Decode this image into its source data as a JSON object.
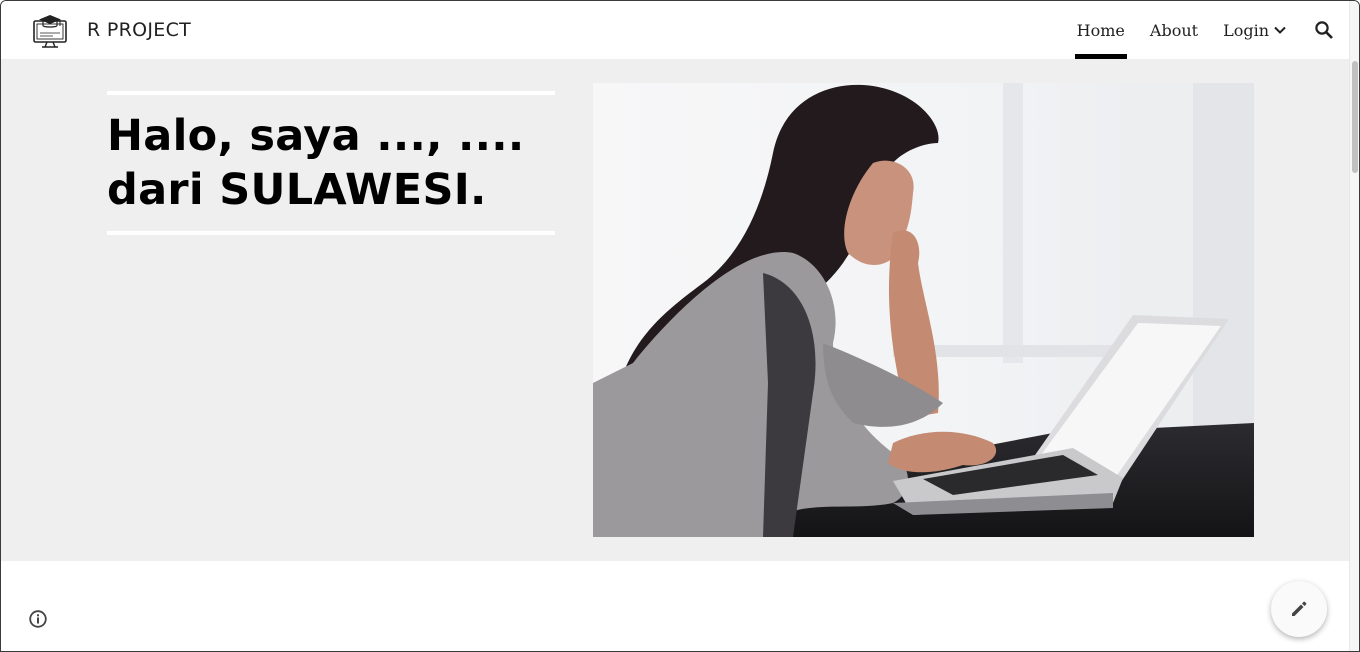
{
  "header": {
    "site_title": "R PROJECT",
    "nav": [
      {
        "label": "Home",
        "active": true
      },
      {
        "label": "About",
        "active": false
      },
      {
        "label": "Login",
        "active": false,
        "has_dropdown": true
      }
    ],
    "search_icon": "search-icon"
  },
  "hero": {
    "headline_line1": "Halo, saya ..., ....",
    "headline_line2": "dari SULAWESI.",
    "image": "woman-typing-on-laptop-photo"
  },
  "footer": {
    "info_icon": "info-icon",
    "edit_icon": "pencil-icon"
  },
  "colors": {
    "hero_background": "#efefef",
    "active_tab_underline": "#000000",
    "header_background": "#ffffff"
  }
}
